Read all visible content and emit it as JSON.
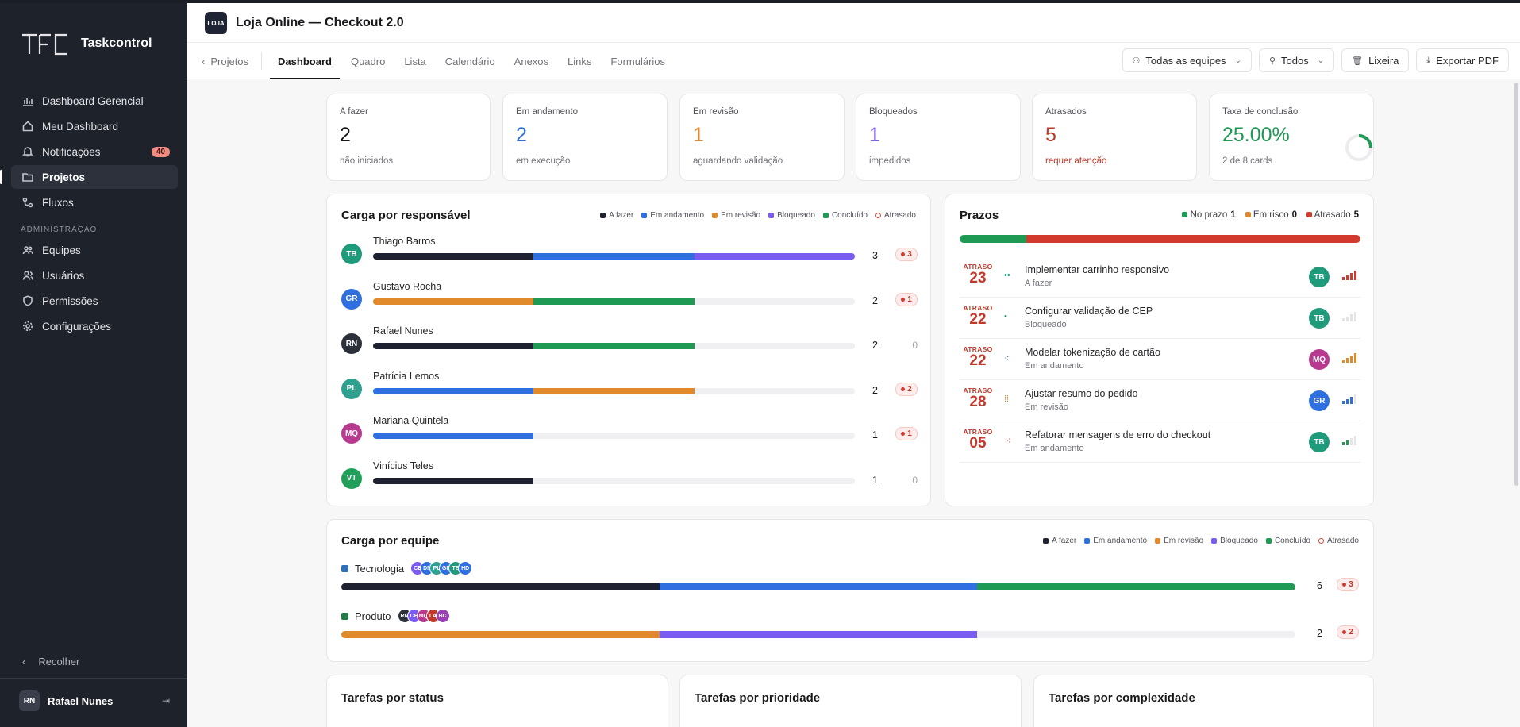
{
  "app": {
    "name": "Taskcontrol"
  },
  "sidebar": {
    "items": [
      {
        "label": "Dashboard Gerencial",
        "icon": "bar-chart-icon"
      },
      {
        "label": "Meu Dashboard",
        "icon": "home-icon"
      },
      {
        "label": "Notificações",
        "icon": "bell-icon",
        "badge": "40"
      },
      {
        "label": "Projetos",
        "icon": "folder-icon",
        "active": true
      },
      {
        "label": "Fluxos",
        "icon": "flow-icon"
      }
    ],
    "admin_label": "ADMINISTRAÇÃO",
    "admin_items": [
      {
        "label": "Equipes",
        "icon": "team-icon"
      },
      {
        "label": "Usuários",
        "icon": "users-icon"
      },
      {
        "label": "Permissões",
        "icon": "shield-icon"
      },
      {
        "label": "Configurações",
        "icon": "gear-icon"
      }
    ],
    "collapse_label": "Recolher",
    "user": {
      "initials": "RN",
      "name": "Rafael Nunes"
    }
  },
  "header": {
    "logo_text": "LOJA",
    "title": "Loja Online — Checkout 2.0",
    "back_label": "Projetos",
    "tabs": [
      "Dashboard",
      "Quadro",
      "Lista",
      "Calendário",
      "Anexos",
      "Links",
      "Formulários"
    ],
    "actions": {
      "teams": "Todas as equipes",
      "people": "Todos",
      "trash": "Lixeira",
      "export": "Exportar PDF"
    }
  },
  "kpis": [
    {
      "label": "A fazer",
      "value": "2",
      "sub": "não iniciados",
      "color": "#18181b"
    },
    {
      "label": "Em andamento",
      "value": "2",
      "sub": "em execução",
      "color": "#2f6fdf"
    },
    {
      "label": "Em revisão",
      "value": "1",
      "sub": "aguardando validação",
      "color": "#e08a2c"
    },
    {
      "label": "Bloqueados",
      "value": "1",
      "sub": "impedidos",
      "color": "#7b5cf0"
    },
    {
      "label": "Atrasados",
      "value": "5",
      "sub": "requer atenção",
      "color": "#c0392b"
    },
    {
      "label": "Taxa de conclusão",
      "value": "25.00%",
      "sub": "2 de 8 cards",
      "color": "#1f9a55",
      "progress": 0.25
    }
  ],
  "colors": {
    "todo": "#1e2230",
    "doing": "#2f6fdf",
    "review": "#e08a2c",
    "blocked": "#7b5cf0",
    "done": "#1f9a55",
    "late": "#d23a2d"
  },
  "legend": [
    "A fazer",
    "Em andamento",
    "Em revisão",
    "Bloqueado",
    "Concluído",
    "Atrasado"
  ],
  "people": {
    "title": "Carga por responsável",
    "rows": [
      {
        "initials": "TB",
        "name": "Thiago Barros",
        "color": "#1f9a7a",
        "segs": [
          [
            "todo",
            1
          ],
          [
            "doing",
            1
          ],
          [
            "blocked",
            1
          ]
        ],
        "count": "3",
        "late": "3"
      },
      {
        "initials": "GR",
        "name": "Gustavo Rocha",
        "color": "#2f6fdf",
        "segs": [
          [
            "review",
            1
          ],
          [
            "done",
            1
          ]
        ],
        "count": "2",
        "late": "1"
      },
      {
        "initials": "RN",
        "name": "Rafael Nunes",
        "color": "#2b303b",
        "segs": [
          [
            "todo",
            1
          ],
          [
            "done",
            1
          ]
        ],
        "count": "2",
        "late": "0"
      },
      {
        "initials": "PL",
        "name": "Patrícia Lemos",
        "color": "#2fa08f",
        "segs": [
          [
            "doing",
            1
          ],
          [
            "review",
            1
          ]
        ],
        "count": "2",
        "late": "2"
      },
      {
        "initials": "MQ",
        "name": "Mariana Quintela",
        "color": "#b83a8f",
        "segs": [
          [
            "doing",
            1
          ]
        ],
        "count": "1",
        "late": "1"
      },
      {
        "initials": "VT",
        "name": "Vinícius Teles",
        "color": "#22a05a",
        "segs": [
          [
            "todo",
            1
          ]
        ],
        "count": "1",
        "late": "0"
      }
    ]
  },
  "deadlines": {
    "title": "Prazos",
    "legend": [
      {
        "label": "No prazo",
        "value": "1",
        "color": "#1f9a55"
      },
      {
        "label": "Em risco",
        "value": "0",
        "color": "#e08a2c"
      },
      {
        "label": "Atrasado",
        "value": "5",
        "color": "#d23a2d"
      }
    ],
    "ontime_fraction": 0.166,
    "rows": [
      {
        "tag": "ATRASO",
        "day": "23",
        "title": "Implementar carrinho responsivo",
        "status": "A fazer",
        "glyph": "••",
        "glyph_color": "#1f9a7a",
        "initials": "TB",
        "av_color": "#1f9a7a",
        "level": 4,
        "level_color": "#d23a2d"
      },
      {
        "tag": "ATRASO",
        "day": "22",
        "title": "Configurar validação de CEP",
        "status": "Bloqueado",
        "glyph": "•",
        "glyph_color": "#1f9a7a",
        "initials": "TB",
        "av_color": "#1f9a7a",
        "level": 0,
        "level_color": "#d4d4d8"
      },
      {
        "tag": "ATRASO",
        "day": "22",
        "title": "Modelar tokenização de cartão",
        "status": "Em andamento",
        "glyph": "⁖",
        "glyph_color": "#2f6fdf",
        "initials": "MQ",
        "av_color": "#b83a8f",
        "level": 4,
        "level_color": "#e08a2c"
      },
      {
        "tag": "ATRASO",
        "day": "28",
        "title": "Ajustar resumo do pedido",
        "status": "Em revisão",
        "glyph": "⁞⁞",
        "glyph_color": "#e08a2c",
        "initials": "GR",
        "av_color": "#2f6fdf",
        "level": 3,
        "level_color": "#2f6fdf"
      },
      {
        "tag": "ATRASO",
        "day": "05",
        "title": "Refatorar mensagens de erro do checkout",
        "status": "Em andamento",
        "glyph": "⁙",
        "glyph_color": "#d23a2d",
        "initials": "TB",
        "av_color": "#1f9a7a",
        "level": 2,
        "level_color": "#1f9a55"
      }
    ]
  },
  "teams": {
    "title": "Carga por equipe",
    "rows": [
      {
        "name": "Tecnologia",
        "color": "#2f6fb5",
        "members": [
          [
            "CE",
            "#7b5cf0"
          ],
          [
            "DN",
            "#2f6fdf"
          ],
          [
            "PL",
            "#2fa08f"
          ],
          [
            "GR",
            "#2f6fdf"
          ],
          [
            "TB",
            "#1f9a7a"
          ],
          [
            "HD",
            "#2f6fdf"
          ]
        ],
        "segs": [
          [
            "todo",
            1
          ],
          [
            "doing",
            1
          ],
          [
            "done",
            1
          ]
        ],
        "count": "6",
        "late": "3"
      },
      {
        "name": "Produto",
        "color": "#1f7a45",
        "members": [
          [
            "RN",
            "#2b303b"
          ],
          [
            "CE",
            "#7b5cf0"
          ],
          [
            "MQ",
            "#b83a8f"
          ],
          [
            "LA",
            "#c0392b"
          ],
          [
            "BC",
            "#9b3fb5"
          ]
        ],
        "segs": [
          [
            "review",
            1
          ],
          [
            "blocked",
            1
          ]
        ],
        "count": "2",
        "late": "2"
      }
    ]
  },
  "bottom_cards": [
    "Tarefas por status",
    "Tarefas por prioridade",
    "Tarefas por complexidade"
  ]
}
